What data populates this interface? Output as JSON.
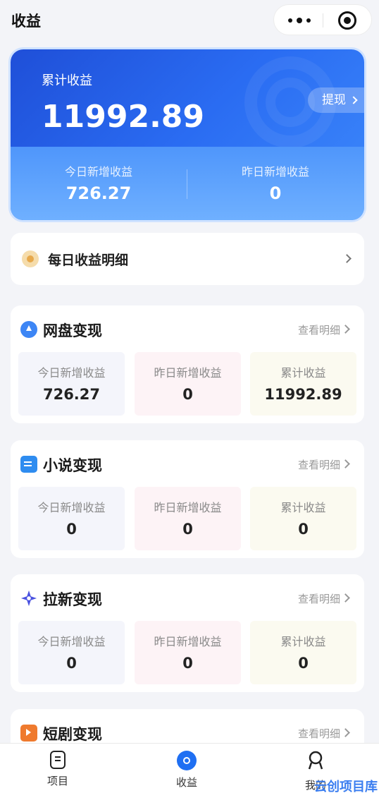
{
  "header": {
    "title": "收益"
  },
  "hero": {
    "label": "累计收益",
    "total": "11992.89",
    "withdraw_label": "提现",
    "today_label": "今日新增收益",
    "today_value": "726.27",
    "yesterday_label": "昨日新增收益",
    "yesterday_value": "0"
  },
  "daily": {
    "label": "每日收益明细"
  },
  "sections": [
    {
      "title": "网盘变现",
      "detail": "查看明细",
      "tiles": [
        {
          "label": "今日新增收益",
          "value": "726.27"
        },
        {
          "label": "昨日新增收益",
          "value": "0"
        },
        {
          "label": "累计收益",
          "value": "11992.89"
        }
      ]
    },
    {
      "title": "小说变现",
      "detail": "查看明细",
      "tiles": [
        {
          "label": "今日新增收益",
          "value": "0"
        },
        {
          "label": "昨日新增收益",
          "value": "0"
        },
        {
          "label": "累计收益",
          "value": "0"
        }
      ]
    },
    {
      "title": "拉新变现",
      "detail": "查看明细",
      "tiles": [
        {
          "label": "今日新增收益",
          "value": "0"
        },
        {
          "label": "昨日新增收益",
          "value": "0"
        },
        {
          "label": "累计收益",
          "value": "0"
        }
      ]
    },
    {
      "title": "短剧变现",
      "detail": "查看明细"
    }
  ],
  "tabbar": [
    {
      "label": "项目",
      "icon": "project-icon"
    },
    {
      "label": "收益",
      "icon": "earnings-icon",
      "active": true
    },
    {
      "label": "我的",
      "icon": "profile-icon"
    }
  ],
  "watermark": "云创项目库",
  "colors": {
    "accent": "#1f6ff2",
    "hero_start": "#1f4fd8",
    "hero_end": "#6fb0ff"
  }
}
